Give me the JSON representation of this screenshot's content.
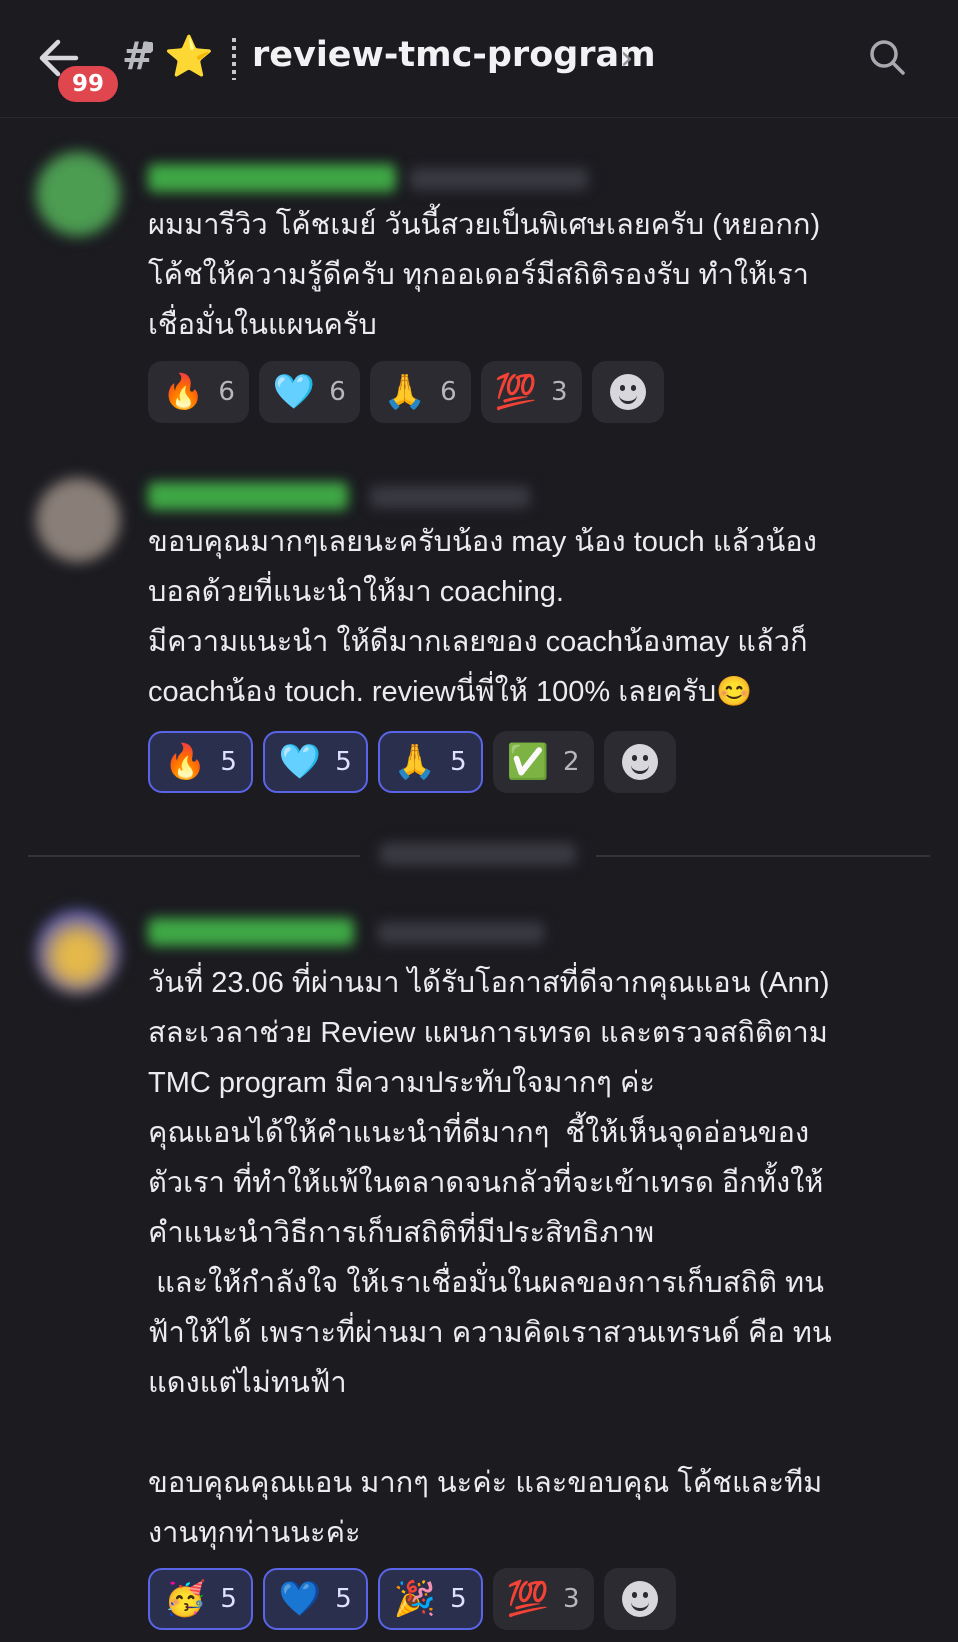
{
  "header": {
    "back_icon": "arrow-left-icon",
    "unread_badge": "99",
    "hash_symbol": "#",
    "star_icon": "⭐",
    "channel_name": "review-tmc-program",
    "chevron": "›",
    "search_icon": "search-icon"
  },
  "colors": {
    "background": "#1b1b20",
    "badge": "#e0464e",
    "active_reaction_border": "#5a64e6",
    "username_green": "#3fa845"
  },
  "messages": [
    {
      "text": "ผมมารีวิว โค้ชเมย์ วันนี้สวยเป็นพิเศษเลยครับ (หยอกก)\nโค้ชให้ความรู้ดีครับ ทุกออเดอร์มีสถิติรองรับ ทำให้เรา\nเชื่อมั่นในแผนครับ",
      "reactions": [
        {
          "emoji": "🔥",
          "count": "6"
        },
        {
          "emoji": "🩵",
          "count": "6"
        },
        {
          "emoji": "🙏",
          "count": "6"
        },
        {
          "emoji": "💯",
          "count": "3"
        }
      ]
    },
    {
      "text": "ขอบคุณมากๆเลยนะครับน้อง may น้อง touch แล้วน้อง\nบอลด้วยที่แนะนำให้มา coaching.\nมีความแนะนำ ให้ดีมากเลยของ coachน้องmay แล้วก็\ncoachน้อง touch. reviewนี่พี่ให้ 100% เลยครับ😊",
      "reactions": [
        {
          "emoji": "🔥",
          "count": "5"
        },
        {
          "emoji": "🩵",
          "count": "5"
        },
        {
          "emoji": "🙏",
          "count": "5"
        },
        {
          "emoji": "✅",
          "count": "2"
        }
      ]
    },
    {
      "text": "วันที่ 23.06 ที่ผ่านมา ได้รับโอกาสที่ดีจากคุณแอน (Ann)\nสละเวลาช่วย Review แผนการเทรด และตรวจสถิติตาม\nTMC program มีความประทับใจมากๆ ค่ะ\nคุณแอนได้ให้คำแนะนำที่ดีมากๆ  ชี้ให้เห็นจุดอ่อนของ\nตัวเรา ที่ทำให้แพ้ในตลาดจนกลัวที่จะเข้าเทรด อีกทั้งให้\nคำแนะนำวิธีการเก็บสถิติที่มีประสิทธิภาพ\n และให้กำลังใจ ให้เราเชื่อมั่นในผลของการเก็บสถิติ ทน\nฟ้าให้ได้ เพราะที่ผ่านมา ความคิดเราสวนเทรนด์ คือ ทน\nแดงแต่ไม่ทนฟ้า\n\nขอบคุณคุณแอน มากๆ นะค่ะ และขอบคุณ โค้ชและทีม\nงานทุกท่านนะค่ะ",
      "reactions": [
        {
          "emoji": "🥳",
          "count": "5"
        },
        {
          "emoji": "💙",
          "count": "5"
        },
        {
          "emoji": "🎉",
          "count": "5"
        },
        {
          "emoji": "💯",
          "count": "3"
        }
      ]
    }
  ]
}
